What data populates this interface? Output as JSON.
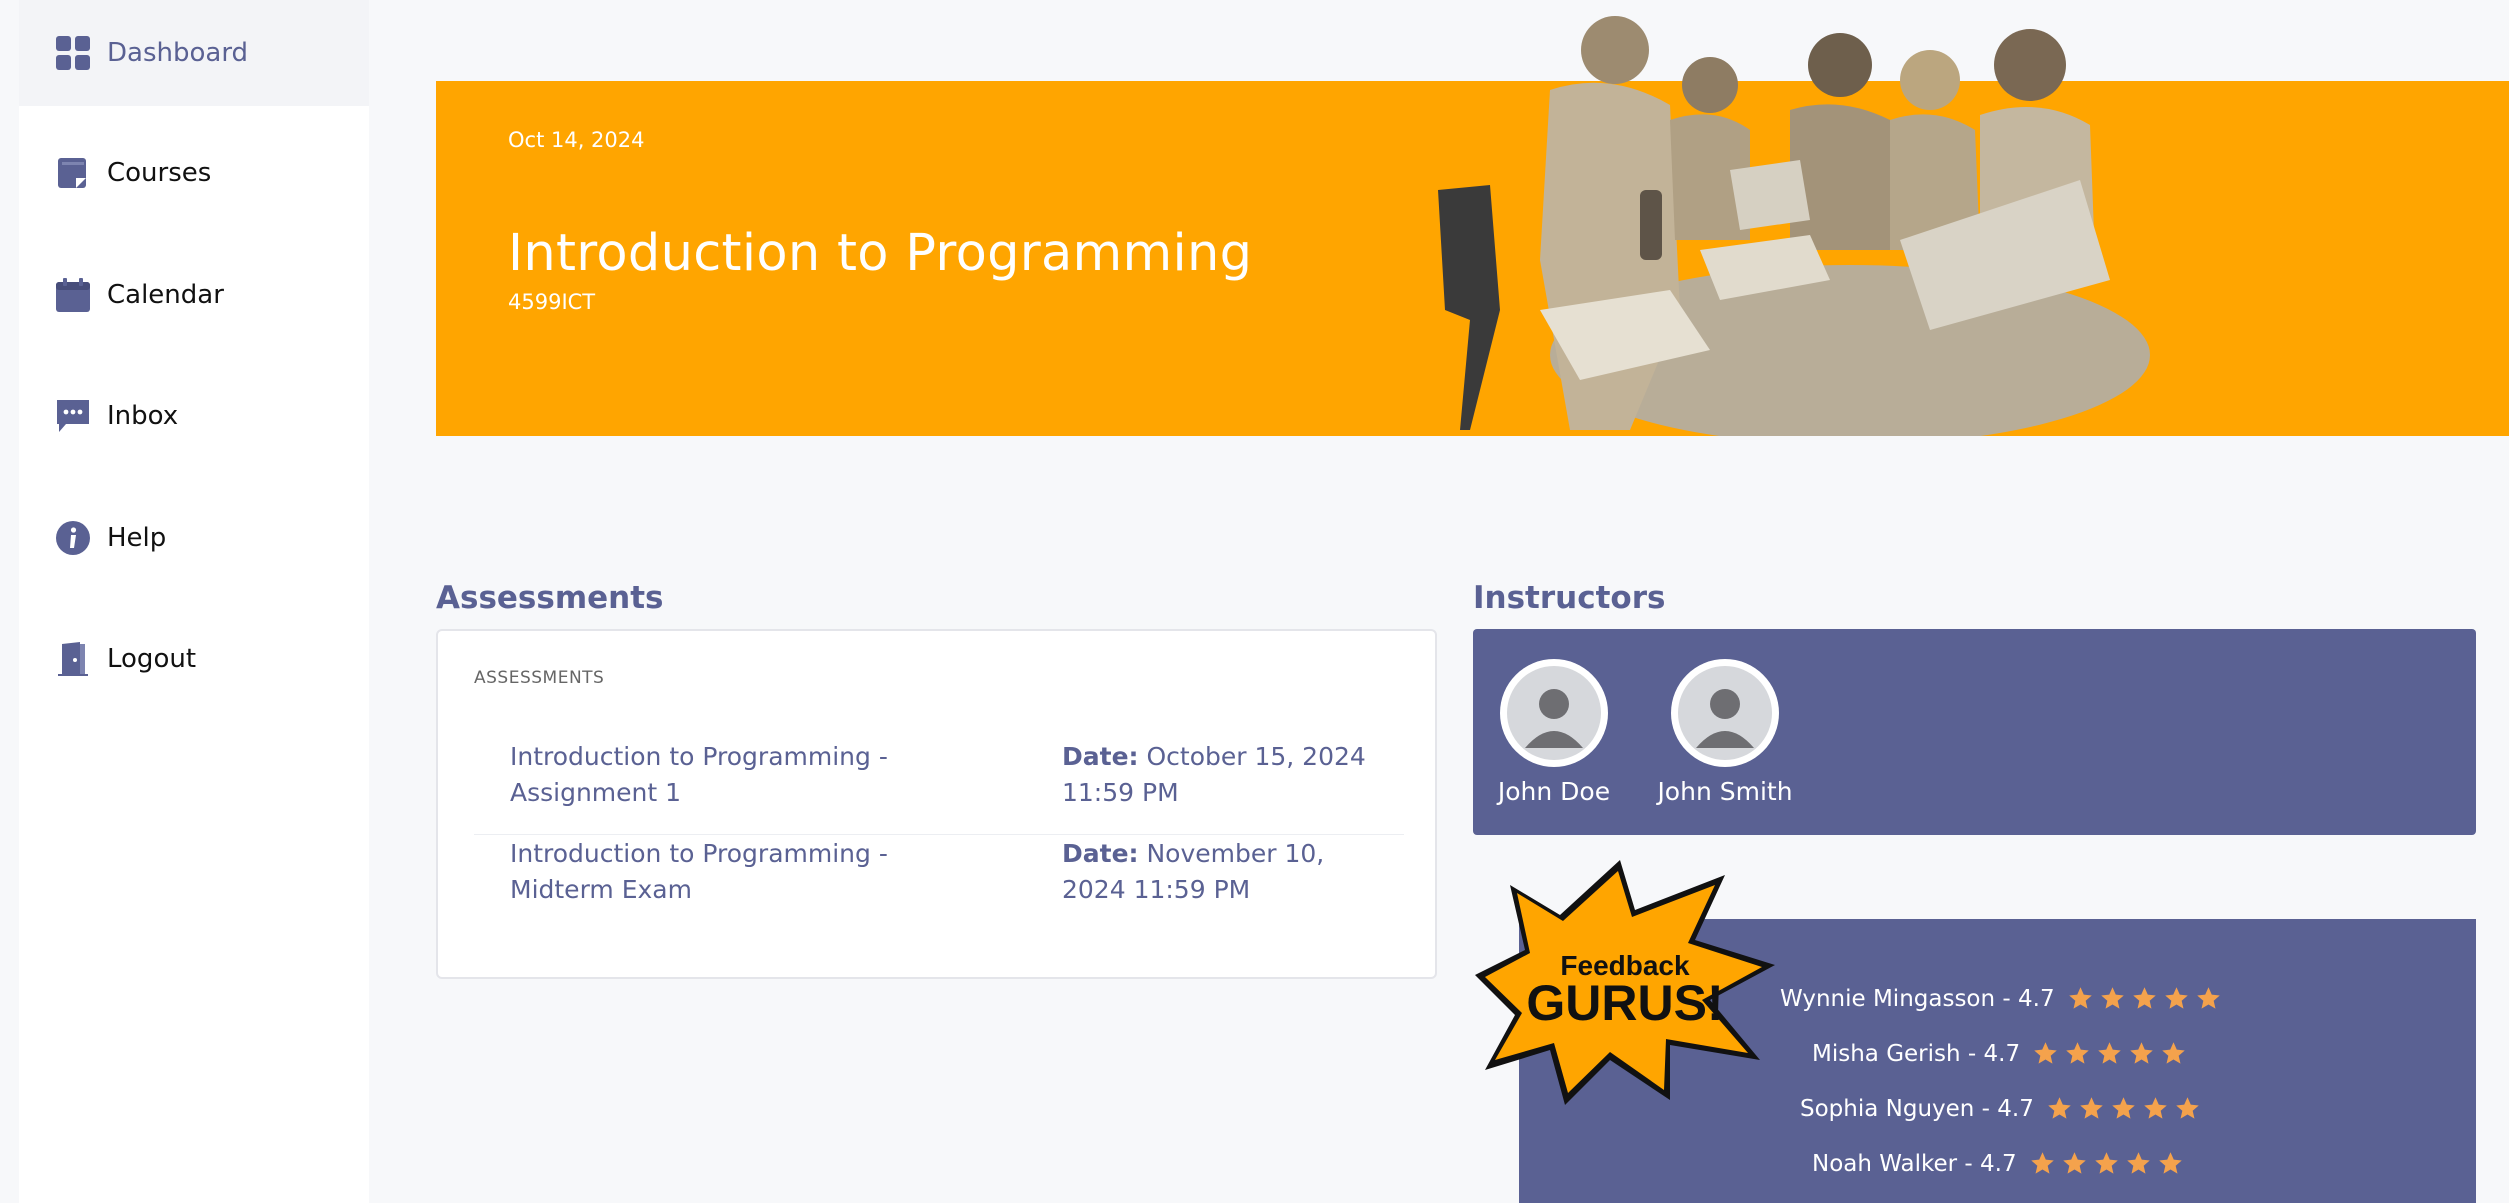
{
  "sidebar": {
    "items": [
      {
        "label": "Dashboard",
        "icon": "grid-icon",
        "active": true
      },
      {
        "label": "Courses",
        "icon": "book-icon"
      },
      {
        "label": "Calendar",
        "icon": "calendar-icon"
      },
      {
        "label": "Inbox",
        "icon": "chat-icon"
      },
      {
        "label": "Help",
        "icon": "info-icon"
      },
      {
        "label": "Logout",
        "icon": "door-icon"
      }
    ]
  },
  "course": {
    "date": "Oct 14, 2024",
    "title": "Introduction to Programming",
    "code": "4599ICT"
  },
  "assessments": {
    "section_title": "Assessments",
    "card_heading": "ASSESSMENTS",
    "date_label": "Date:",
    "items": [
      {
        "name": "Introduction to Programming - Assignment 1",
        "date": "October 15, 2024 11:59 PM"
      },
      {
        "name": "Introduction to Programming - Midterm Exam",
        "date": "November 10, 2024 11:59 PM"
      }
    ]
  },
  "instructors": {
    "section_title": "Instructors",
    "items": [
      {
        "name": "John Doe"
      },
      {
        "name": "John Smith"
      }
    ]
  },
  "feedback": {
    "badge_line1": "Feedback",
    "badge_line2": "GURUS!",
    "ratings": [
      {
        "text": "Wynnie Mingasson - 4.7",
        "stars": 5
      },
      {
        "text": "Misha Gerish - 4.7",
        "stars": 5
      },
      {
        "text": "Sophia Nguyen - 4.7",
        "stars": 5
      },
      {
        "text": "Noah Walker - 4.7",
        "stars": 5
      }
    ]
  },
  "colors": {
    "brand": "#5a6193",
    "accent": "#ffa500",
    "star": "#f4a24c"
  }
}
